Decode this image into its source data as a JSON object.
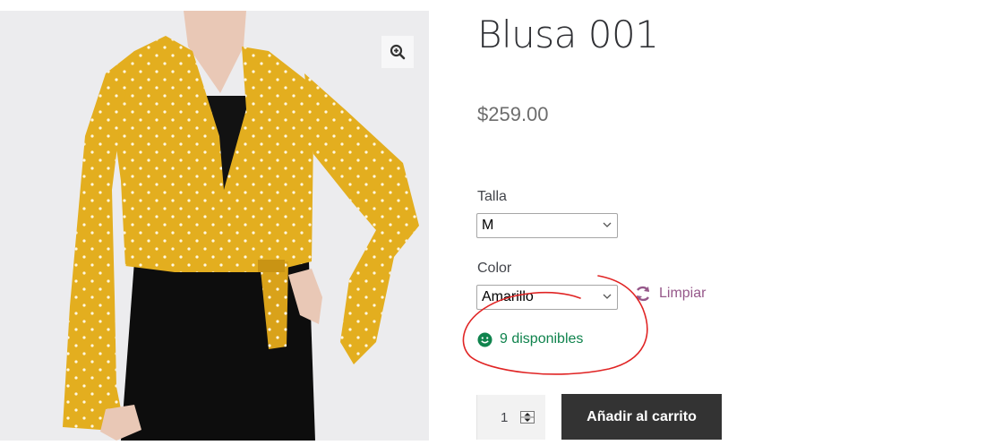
{
  "product": {
    "title": "Blusa 001",
    "price": "$259.00"
  },
  "variations": {
    "size": {
      "label": "Talla",
      "selected": "M"
    },
    "color": {
      "label": "Color",
      "selected": "Amarillo"
    },
    "clear_label": "Limpiar"
  },
  "stock": {
    "text": "9 disponibles"
  },
  "cart": {
    "quantity": "1",
    "add_label": "Añadir al carrito"
  },
  "icons": {
    "zoom": "zoom-in-icon",
    "clear": "refresh-icon",
    "stock": "smiley-icon"
  },
  "colors": {
    "accent": "#96588a",
    "stock_green": "#0f834d",
    "button_dark": "#333333",
    "annotation_red": "#e02424",
    "blouse_mustard": "#e3ae1f"
  }
}
